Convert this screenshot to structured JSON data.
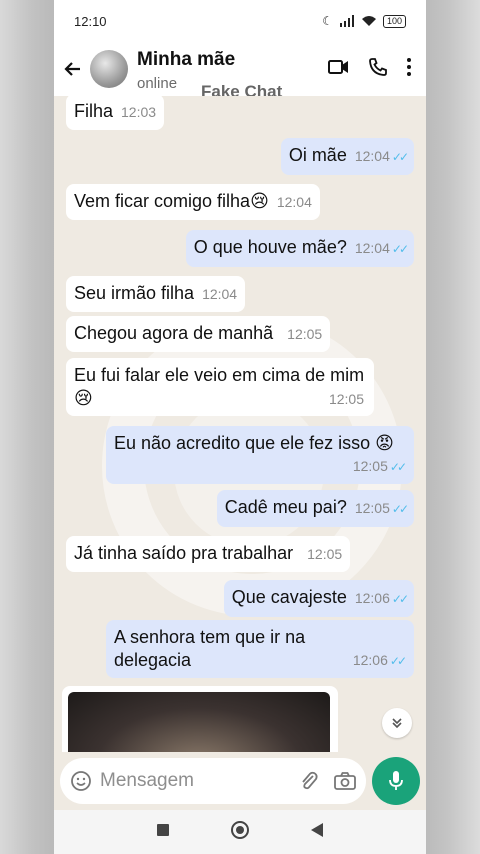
{
  "status_bar": {
    "time": "12:10",
    "battery": "100"
  },
  "header": {
    "contact_name": "Minha mãe",
    "contact_status": "online",
    "watermark": "Fake Chat"
  },
  "messages": [
    {
      "text": "Filha",
      "time": "12:03",
      "direction": "in"
    },
    {
      "text": "Oi mãe",
      "time": "12:04",
      "direction": "out"
    },
    {
      "text": "Vem ficar comigo filha😢",
      "time": "12:04",
      "direction": "in"
    },
    {
      "text": "O que houve mãe?",
      "time": "12:04",
      "direction": "out"
    },
    {
      "text": "Seu irmão filha",
      "time": "12:04",
      "direction": "in"
    },
    {
      "text": "Chegou agora de manhã",
      "time": "12:05",
      "direction": "in"
    },
    {
      "text": "Eu fui falar ele veio em cima de mim😢",
      "time": "12:05",
      "direction": "in"
    },
    {
      "text": "Eu não acredito que ele fez isso 😡",
      "time": "12:05",
      "direction": "out"
    },
    {
      "text": "Cadê meu pai?",
      "time": "12:05",
      "direction": "out"
    },
    {
      "text": "Já tinha saído pra trabalhar",
      "time": "12:05",
      "direction": "in"
    },
    {
      "text": "Que cavajeste",
      "time": "12:06",
      "direction": "out"
    },
    {
      "text": "A senhora tem que ir na delegacia",
      "time": "12:06",
      "direction": "out"
    }
  ],
  "input": {
    "placeholder": "Mensagem"
  },
  "colors": {
    "accent": "#1aa37a",
    "read_ticks": "#53bdeb",
    "outgoing_bubble": "#dde6fb",
    "incoming_bubble": "#ffffff"
  },
  "icons": {
    "back": "arrow-left-icon",
    "video": "video-call-icon",
    "call": "phone-icon",
    "menu": "more-vert-icon",
    "emoji": "emoji-icon",
    "attach": "paperclip-icon",
    "camera": "camera-icon",
    "mic": "mic-icon",
    "scroll": "chevron-double-down-icon"
  }
}
